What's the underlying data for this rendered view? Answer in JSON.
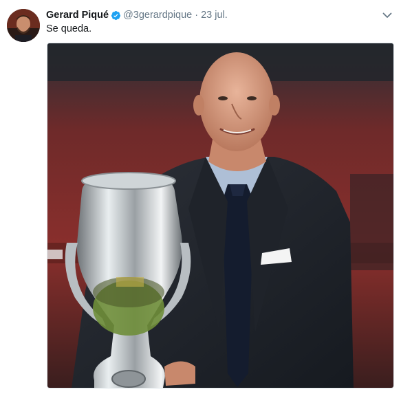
{
  "tweet": {
    "author": {
      "display_name": "Gerard Piqué",
      "handle": "@3gerardpique",
      "verified": true,
      "avatar_icon": "avatar-photo"
    },
    "separator": "·",
    "date": "23 jul.",
    "text": "Se queda.",
    "menu_icon": "chevron-down-icon"
  },
  "colors": {
    "verified_blue": "#1da1f2",
    "secondary_text": "#657786",
    "primary_text": "#14171a"
  }
}
